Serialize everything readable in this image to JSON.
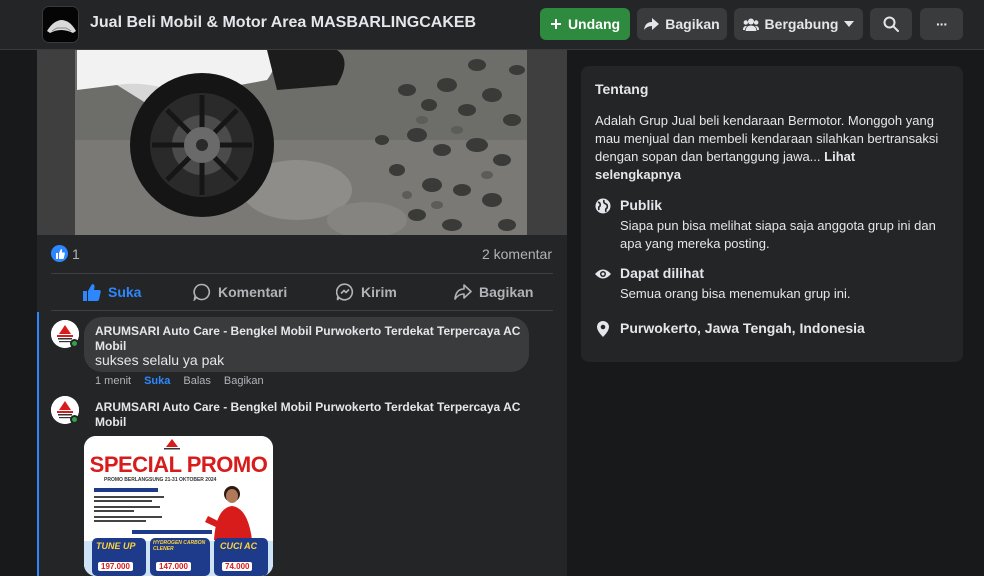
{
  "header": {
    "group_name": "Jual Beli Mobil & Motor Area MASBARLINGCAKEB",
    "invite_label": "Undang",
    "share_label": "Bagikan",
    "join_label": "Bergabung",
    "more_label": "···"
  },
  "post": {
    "like_count": "1",
    "comment_count": "2 komentar",
    "actions": {
      "like": "Suka",
      "comment": "Komentari",
      "send": "Kirim",
      "share": "Bagikan"
    }
  },
  "comments": [
    {
      "author_line1": "ARUMSARI Auto Care - Bengkel Mobil Purwokerto Terdekat Terpercaya AC",
      "author_line2": "Mobil",
      "text": "sukses selalu ya pak",
      "time": "1 menit",
      "like": "Suka",
      "reply": "Balas",
      "share": "Bagikan"
    },
    {
      "author_line1": "ARUMSARI Auto Care - Bengkel Mobil Purwokerto Terdekat Terpercaya AC",
      "author_line2": "Mobil",
      "promo": {
        "title": "SPECIAL PROMO",
        "subtitle": "PROMO BERLANGSUNG 21-31 OKTOBER 2024",
        "tiers": [
          {
            "label": "TUNE UP",
            "price": "197.000"
          },
          {
            "label": "HYDROGEN CARBON CLENER",
            "price": "147.000"
          },
          {
            "label": "CUCI AC",
            "price": "74.000"
          }
        ]
      }
    }
  ],
  "about": {
    "title": "Tentang",
    "description": "Adalah Grup Jual beli kendaraan Bermotor. Monggoh yang mau menjual dan membeli kendaraan silahkan bertransaksi dengan sopan dan bertanggung jawa...",
    "see_more": "Lihat selengkapnya",
    "items": [
      {
        "icon": "globe-icon",
        "title": "Publik",
        "subtitle": "Siapa pun bisa melihat siapa saja anggota grup ini dan apa yang mereka posting."
      },
      {
        "icon": "eye-icon",
        "title": "Dapat dilihat",
        "subtitle": "Semua orang bisa menemukan grup ini."
      },
      {
        "icon": "location-pin-icon",
        "title": "Purwokerto, Jawa Tengah, Indonesia",
        "subtitle": ""
      }
    ]
  },
  "colors": {
    "accent_blue": "#2d88ff",
    "invite_green": "#2d8a3e",
    "background": "#18191a",
    "card": "#242526"
  }
}
